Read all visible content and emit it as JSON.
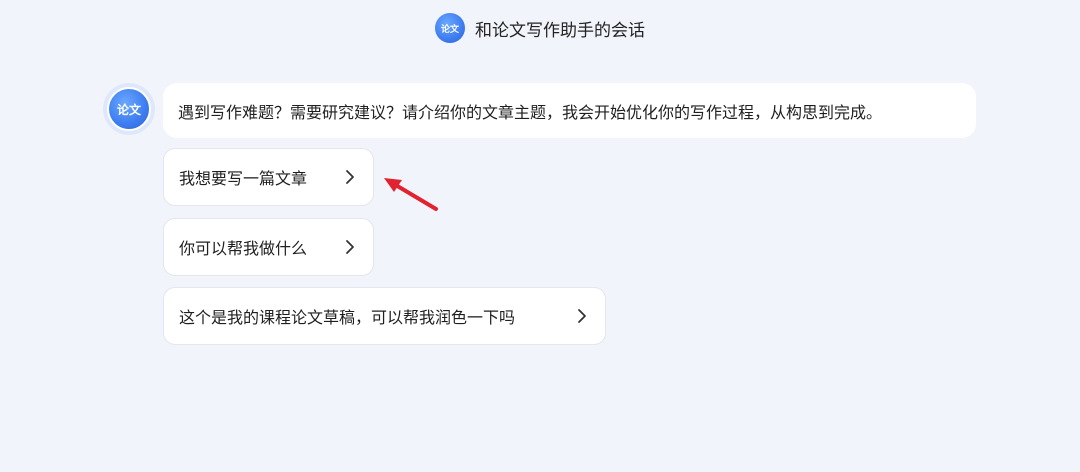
{
  "header": {
    "logo_text": "论文",
    "title": "和论文写作助手的会话"
  },
  "assistant": {
    "avatar_text": "论文",
    "message": "遇到写作难题？需要研究建议？请介绍你的文章主题，我会开始优化你的写作过程，从构思到完成。"
  },
  "suggestions": [
    {
      "label": "我想要写一篇文章"
    },
    {
      "label": "你可以帮我做什么"
    },
    {
      "label": "这个是我的课程论文草稿，可以帮我润色一下吗"
    }
  ],
  "annotation": {
    "arrow_color": "#e0232e"
  },
  "colors": {
    "background": "#f2f4fb",
    "accent": "#3d7cf0"
  },
  "icons": {
    "chevron": "chevron-right-icon",
    "annotation_arrow": "red-arrow-annotation"
  }
}
